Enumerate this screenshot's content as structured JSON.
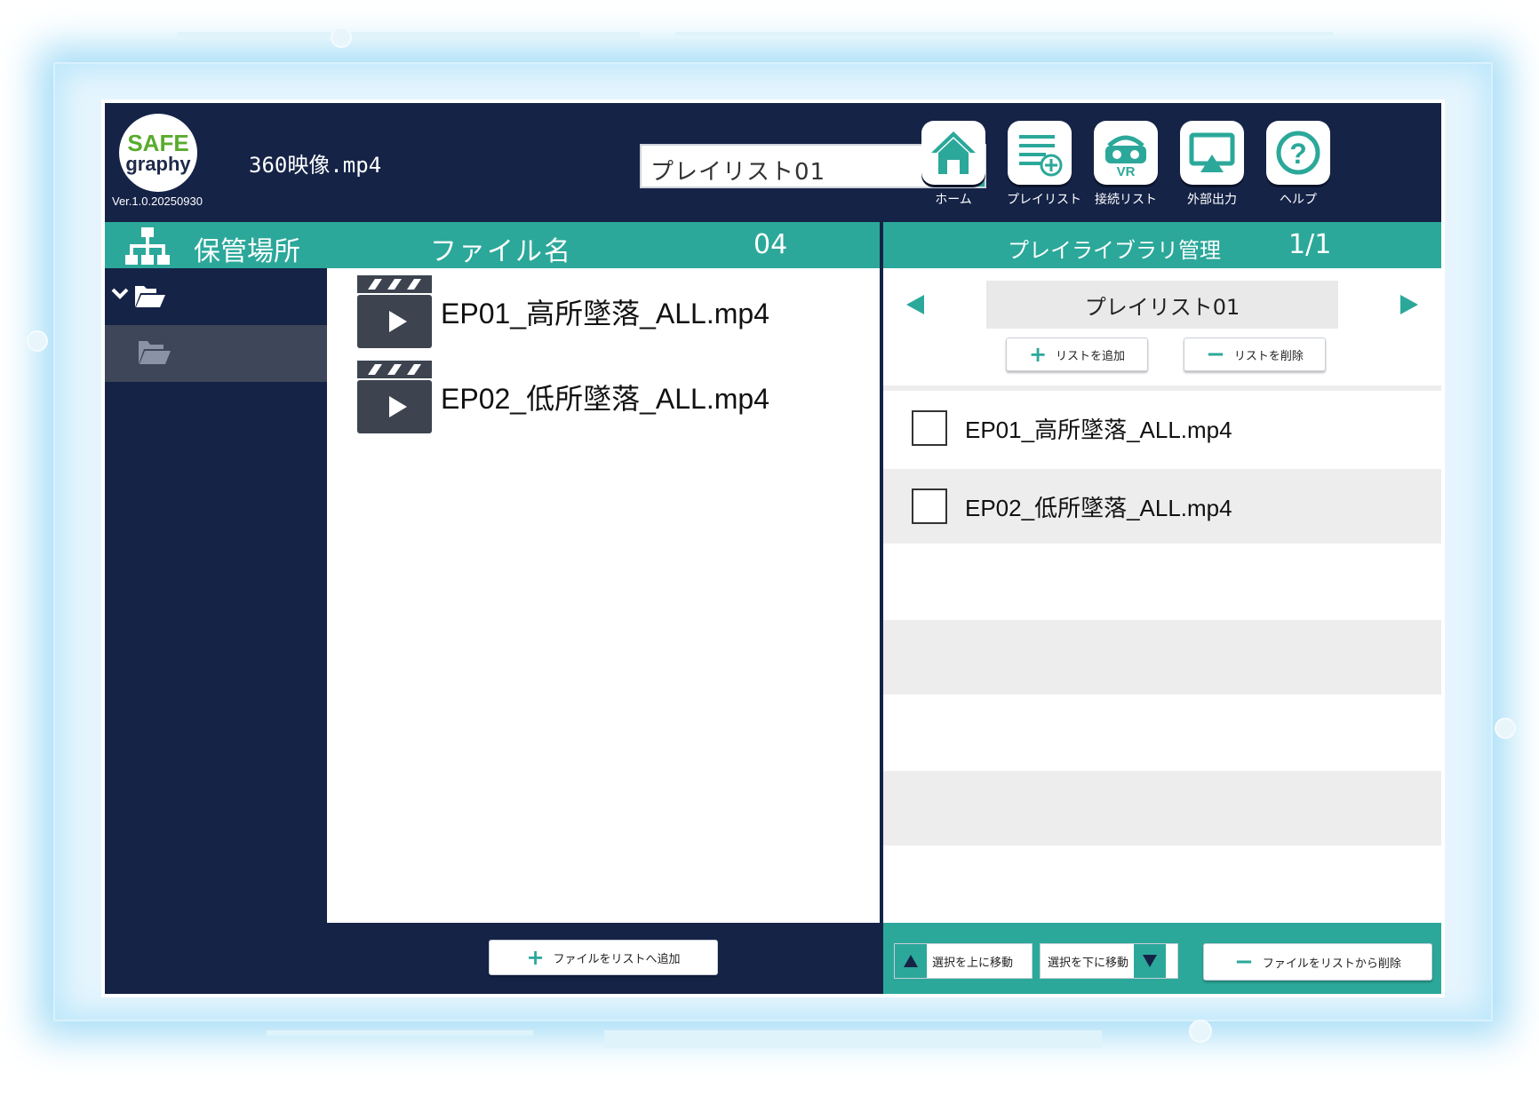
{
  "logo": {
    "line1": "SAFE",
    "line2": "graphy"
  },
  "version": "Ver.1.0.20250930",
  "current_file": "360映像.mp4",
  "playlist_select": {
    "value": "プレイリスト01"
  },
  "nav": [
    {
      "label": "ホーム",
      "icon": "home-icon"
    },
    {
      "label": "プレイリスト",
      "icon": "playlist-add-icon"
    },
    {
      "label": "接続リスト",
      "icon": "vr-headset-icon"
    },
    {
      "label": "外部出力",
      "icon": "monitor-icon"
    },
    {
      "label": "ヘルプ",
      "icon": "help-icon"
    }
  ],
  "left_bar": {
    "storage_label": "保管場所",
    "file_name_label": "ファイル名",
    "file_count": "04"
  },
  "right_bar": {
    "title": "プレイライブラリ管理",
    "page": "1/1"
  },
  "files": [
    {
      "name": "EP01_高所墜落_ALL.mp4"
    },
    {
      "name": "EP02_低所墜落_ALL.mp4"
    }
  ],
  "add_to_list_button": "ファイルをリストへ追加",
  "playlist_panel": {
    "name": "プレイリスト01",
    "add_list_button": "リストを追加",
    "delete_list_button": "リストを削除",
    "items": [
      {
        "name": "EP01_高所墜落_ALL.mp4",
        "checked": false
      },
      {
        "name": "EP02_低所墜落_ALL.mp4",
        "checked": false
      }
    ]
  },
  "footer_right": {
    "move_up": "選択を上に移動",
    "move_down": "選択を下に移動",
    "remove": "ファイルをリストから削除"
  },
  "colors": {
    "navy": "#152347",
    "teal": "#2ba89a",
    "glow": "#a8def7"
  }
}
